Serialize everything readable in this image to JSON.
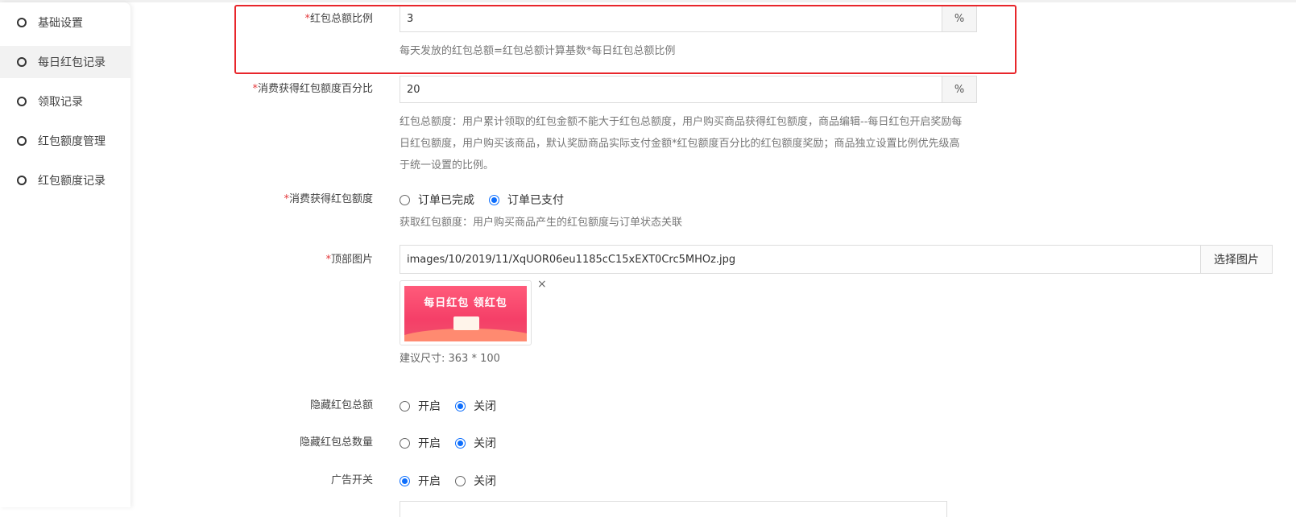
{
  "sidebar": {
    "items": [
      {
        "label": "基础设置",
        "active": false
      },
      {
        "label": "每日红包记录",
        "active": true
      },
      {
        "label": "领取记录",
        "active": false
      },
      {
        "label": "红包额度管理",
        "active": false
      },
      {
        "label": "红包额度记录",
        "active": false
      }
    ]
  },
  "form": {
    "total_ratio": {
      "required": "*",
      "label": "红包总额比例",
      "value": "3",
      "unit": "%",
      "help": "每天发放的红包总额=红包总额计算基数*每日红包总额比例"
    },
    "consume_percent": {
      "required": "*",
      "label": "消费获得红包额度百分比",
      "value": "20",
      "unit": "%",
      "help_lines": [
        "红包总额度：用户累计领取的红包金额不能大于红包总额度，用户购买商品获得红包额度，商品编辑--每日红包开启奖励每",
        "日红包额度，用户购买该商品，默认奖励商品实际支付金额*红包额度百分比的红包额度奖励；商品独立设置比例优先级高",
        "于统一设置的比例。"
      ]
    },
    "consume_quota": {
      "required": "*",
      "label": "消费获得红包额度",
      "options": [
        "订单已完成",
        "订单已支付"
      ],
      "selected": 1,
      "help": "获取红包额度：用户购买商品产生的红包额度与订单状态关联"
    },
    "top_image": {
      "required": "*",
      "label": "顶部图片",
      "value": "images/10/2019/11/XqUOR06eu1185cC15xEXT0Crc5MHOz.jpg",
      "button": "选择图片",
      "preview_text": "每日红包  领红包",
      "close": "×",
      "size_hint": "建议尺寸: 363 * 100"
    },
    "hide_total": {
      "label": "隐藏红包总额",
      "options": [
        "开启",
        "关闭"
      ],
      "selected": 1
    },
    "hide_count": {
      "label": "隐藏红包总数量",
      "options": [
        "开启",
        "关闭"
      ],
      "selected": 1
    },
    "ad_switch": {
      "label": "广告开关",
      "options": [
        "开启",
        "关闭"
      ],
      "selected": 0
    }
  },
  "colors": {
    "required": "#e4393c",
    "highlight": "#e8262b",
    "radio_checked": "#0d6efd"
  }
}
